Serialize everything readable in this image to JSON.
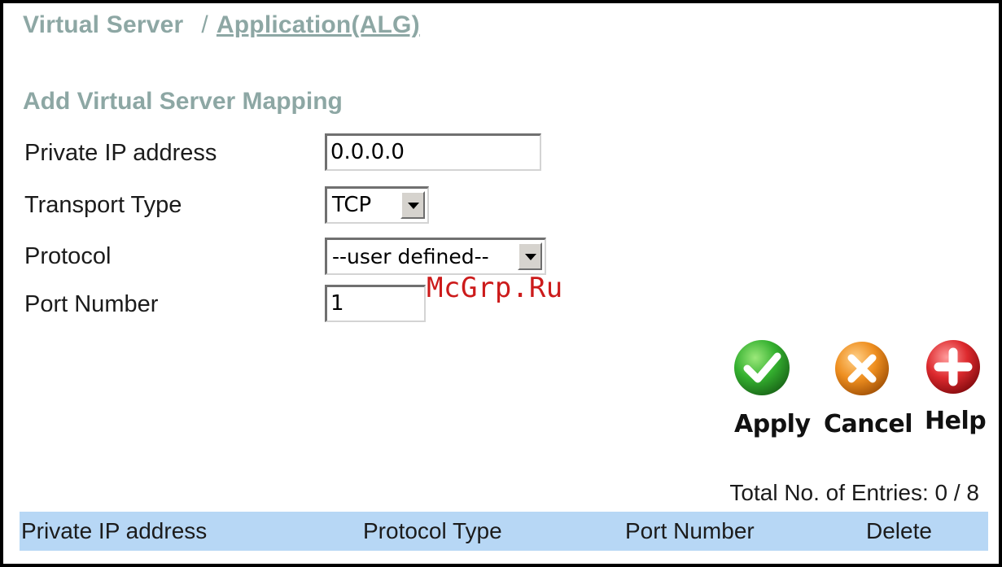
{
  "breadcrumb": {
    "current": "Virtual Server",
    "separator": "/",
    "link": "Application(ALG)"
  },
  "section": {
    "title": "Add Virtual Server Mapping"
  },
  "form": {
    "private_ip": {
      "label": "Private IP address",
      "value": "0.0.0.0"
    },
    "transport_type": {
      "label": "Transport Type",
      "value": "TCP"
    },
    "protocol": {
      "label": "Protocol",
      "value": "--user defined--"
    },
    "port_number": {
      "label": "Port Number",
      "value": "1"
    }
  },
  "watermark": "McGrp.Ru",
  "actions": {
    "apply": {
      "label": "Apply",
      "icon": "check-icon",
      "color": "#2fa52f"
    },
    "cancel": {
      "label": "Cancel",
      "icon": "x-icon",
      "color": "#e88a1c"
    },
    "help": {
      "label": "Help",
      "icon": "plus-icon",
      "color": "#d9262b"
    }
  },
  "entries": {
    "total_text": "Total No. of Entries: 0 / 8"
  },
  "table": {
    "header_color": "#b7d7f5",
    "columns": [
      "Private IP address",
      "Protocol Type",
      "Port Number",
      "Delete"
    ]
  },
  "colors": {
    "heading": "#8da7a4"
  }
}
